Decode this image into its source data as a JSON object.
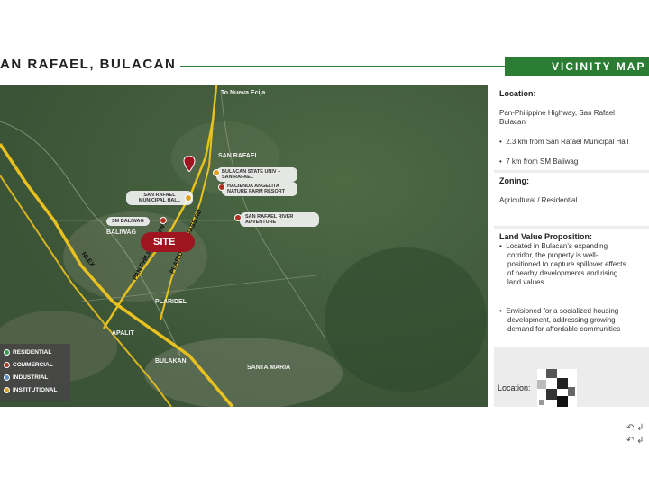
{
  "header": {
    "title": "AN RAFAEL, BULACAN",
    "banner": "VICINITY MAP"
  },
  "map": {
    "site_label": "SITE",
    "places": [
      "To Nueva Ecija",
      "SAN RAFAEL",
      "BALIWAG",
      "PLARIDEL",
      "APALIT",
      "BULAKAN",
      "SANTA MARIA"
    ],
    "roads": [
      "NLEX",
      "PAN PHILIPPINE HWY",
      "PLARIDEL BYPASS RD"
    ],
    "landmarks": [
      "BULACAN STATE UNIV – SAN RAFAEL",
      "HACIENDA ANGELITA NATURE FARM RESORT",
      "SAN RAFAEL MUNICIPAL HALL",
      "SM BALIWAG",
      "SAN RAFAEL RIVER ADVENTURE"
    ]
  },
  "legend": [
    {
      "label": "RESIDENTIAL",
      "color": "#2e9e4a"
    },
    {
      "label": "COMMERCIAL",
      "color": "#b03020"
    },
    {
      "label": "INDUSTRIAL",
      "color": "#5b8bc9"
    },
    {
      "label": "INSTITUTIONAL",
      "color": "#e0a020"
    }
  ],
  "info": {
    "location_heading": "Location:",
    "location_lines": [
      "Pan-Philippine Highway, San Rafael",
      "Bulacan"
    ],
    "location_bullets": [
      "2.3 km from San Rafael Municipal Hall",
      "7 km from SM Baliwag"
    ],
    "zoning_heading": "Zoning:",
    "zoning_text": "Agricultural / Residential",
    "lvp_heading": "Land Value Proposition:",
    "lvp_bullet1": [
      "Located in Bulacan’s expanding",
      "corridor, the property is well-",
      "positioned to capture spillover effects",
      "of nearby developments and rising",
      "land values"
    ],
    "lvp_bullet2": [
      "Envisioned for a socialized housing",
      "development, addressing growing",
      "demand for affordable communities"
    ]
  },
  "qr_label": "Location:",
  "colors": {
    "accent": "#2b7d34",
    "site": "#9e1520",
    "road": "#e8c020"
  }
}
